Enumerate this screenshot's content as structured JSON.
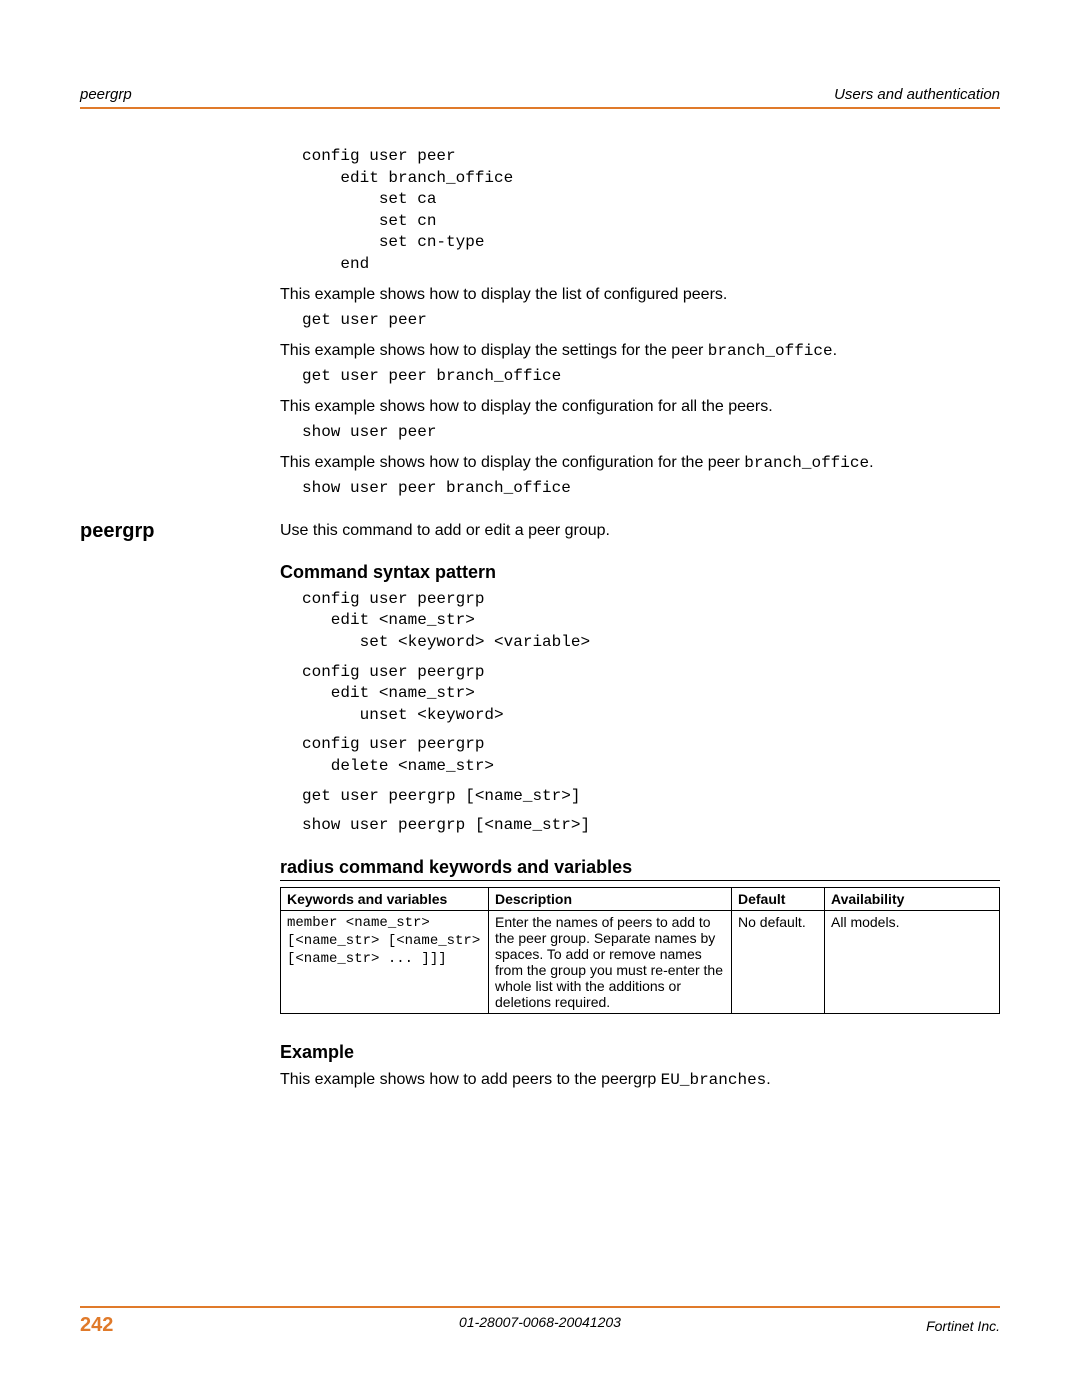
{
  "header": {
    "left": "peergrp",
    "right": "Users and authentication"
  },
  "code_block1": "config user peer\n    edit branch_office\n        set ca\n        set cn\n        set cn-type\n    end",
  "para1": "This example shows how to display the list of configured peers.",
  "code_block2": "get user peer",
  "para2_a": "This example shows how to display the settings for the peer ",
  "para2_code": "branch_office",
  "para2_b": ".",
  "code_block3": "get user peer branch_office",
  "para3": "This example shows how to display the configuration for all the peers.",
  "code_block4": "show user peer",
  "para4_a": "This example shows how to display the configuration for the peer ",
  "para4_code": "branch_office",
  "para4_b": ".",
  "code_block5": "show user peer branch_office",
  "side_heading": "peergrp",
  "para5": "Use this command to add or edit a peer group.",
  "h_syntax": "Command syntax pattern",
  "syntax1": "config user peergrp\n   edit <name_str>\n      set <keyword> <variable>",
  "syntax2": "config user peergrp\n   edit <name_str>\n      unset <keyword>",
  "syntax3": "config user peergrp\n   delete <name_str>",
  "syntax4": "get user peergrp [<name_str>]",
  "syntax5": "show user peergrp [<name_str>]",
  "h_table": " radius command keywords and variables",
  "table": {
    "headers": [
      "Keywords and variables",
      "Description",
      "Default",
      "Availability"
    ],
    "row": {
      "kv": "member <name_str>\n[<name_str> [<name_str>\n[<name_str> ... ]]]",
      "desc": "Enter the names of peers to add to the peer group. Separate names by spaces. To add or remove names from the group you must re-enter the whole list with the additions or deletions required.",
      "def": "No default.",
      "avail": "All models."
    }
  },
  "h_example": "Example",
  "para6_a": "This example shows how to add peers to the peergrp ",
  "para6_code": "EU_branches",
  "para6_b": ".",
  "footer": {
    "page": "242",
    "center": "01-28007-0068-20041203",
    "right": "Fortinet Inc."
  }
}
